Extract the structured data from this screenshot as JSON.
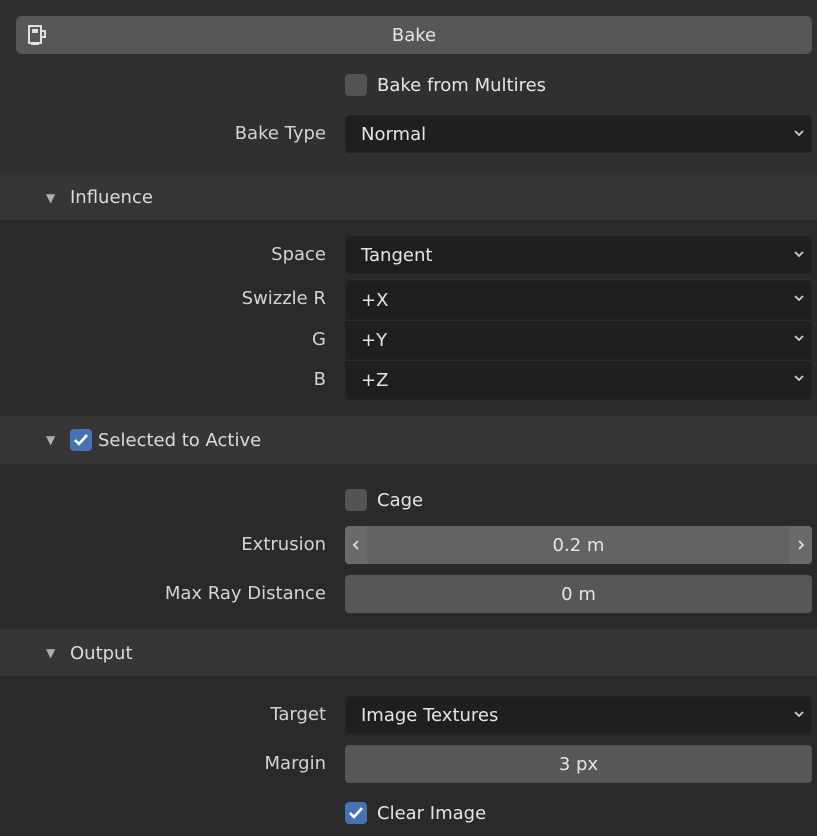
{
  "bake_button": {
    "label": "Bake",
    "icon": "camera-icon"
  },
  "bake_from_multires": {
    "label": "Bake from Multires",
    "checked": false
  },
  "bake_type": {
    "label": "Bake Type",
    "value": "Normal"
  },
  "influence": {
    "title": "Influence",
    "space": {
      "label": "Space",
      "value": "Tangent"
    },
    "swizzle_r": {
      "label": "Swizzle R",
      "value": "+X"
    },
    "g": {
      "label": "G",
      "value": "+Y"
    },
    "b": {
      "label": "B",
      "value": "+Z"
    }
  },
  "selected_to_active": {
    "title": "Selected to Active",
    "checked": true,
    "cage": {
      "label": "Cage",
      "checked": false
    },
    "extrusion": {
      "label": "Extrusion",
      "value": "0.2 m"
    },
    "max_ray_distance": {
      "label": "Max Ray Distance",
      "value": "0 m"
    }
  },
  "output": {
    "title": "Output",
    "target": {
      "label": "Target",
      "value": "Image Textures"
    },
    "margin": {
      "label": "Margin",
      "value": "3 px"
    },
    "clear_image": {
      "label": "Clear Image",
      "checked": true
    }
  },
  "colors": {
    "accent": "#4772b3",
    "panel": "#303030",
    "field": "#575757",
    "dropdown": "#1f1f1f"
  }
}
